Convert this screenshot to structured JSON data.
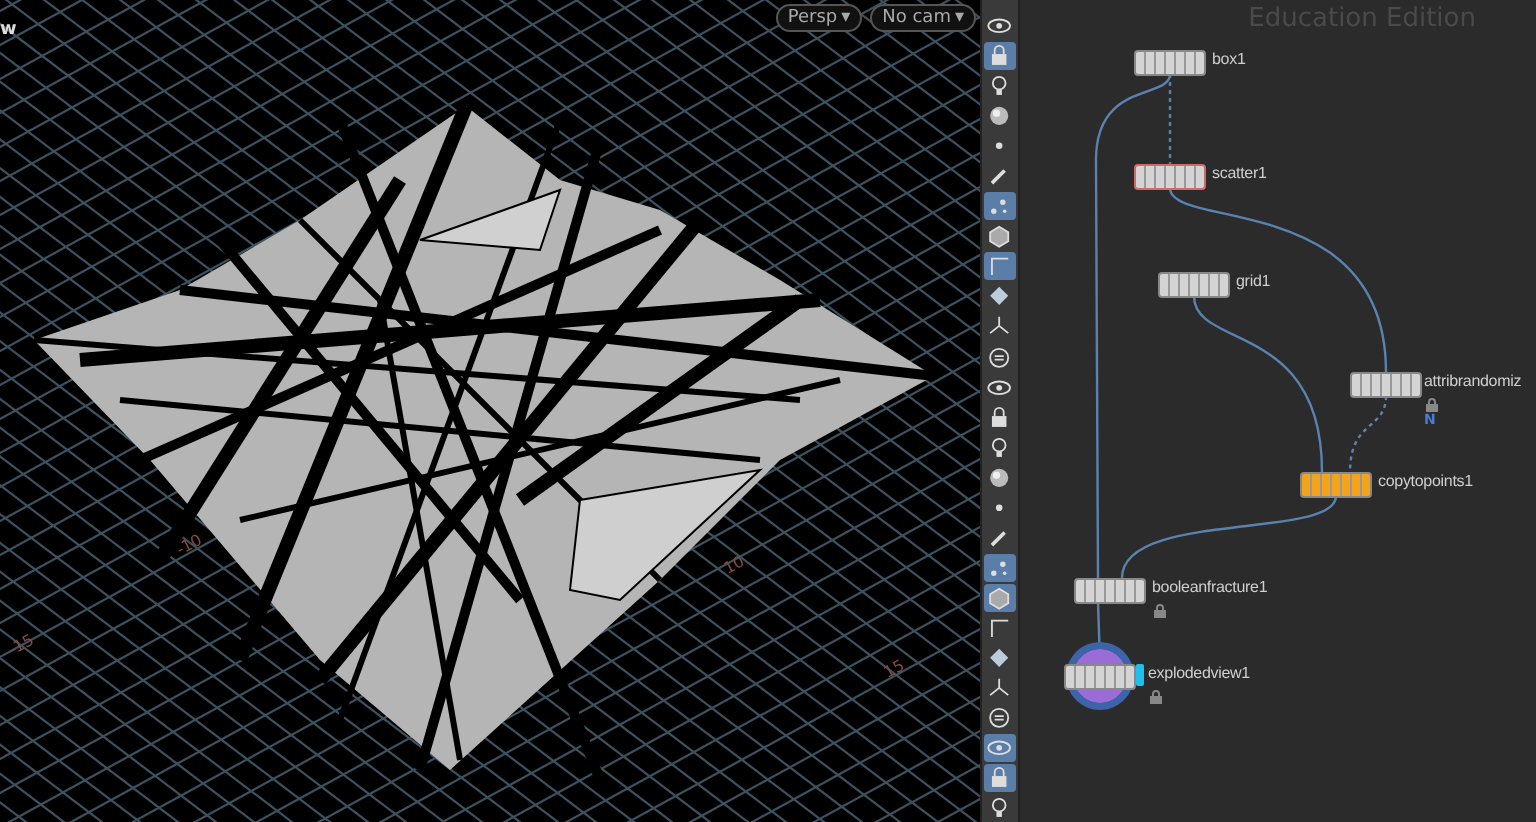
{
  "viewport": {
    "title_fragment": "w",
    "camera_buttons": [
      {
        "label": "Persp",
        "caret": "▾"
      },
      {
        "label": "No cam",
        "caret": "▾"
      }
    ],
    "grid_labels": [
      "-10",
      "-15",
      "10",
      "15"
    ]
  },
  "toolbar": [
    {
      "on": false
    },
    {
      "on": true
    },
    {
      "on": false
    },
    {
      "on": false
    },
    {
      "on": false
    },
    {
      "on": false
    },
    {
      "on": true
    },
    {
      "on": false
    },
    {
      "on": true
    },
    {
      "on": false
    },
    {
      "on": false
    },
    {
      "on": false
    },
    {
      "on": false
    },
    {
      "on": false
    },
    {
      "on": false
    },
    {
      "on": false
    },
    {
      "on": false
    },
    {
      "on": false
    },
    {
      "on": true
    },
    {
      "on": true
    },
    {
      "on": false
    },
    {
      "on": false
    },
    {
      "on": false
    },
    {
      "on": false
    },
    {
      "on": true
    },
    {
      "on": true
    },
    {
      "on": false
    }
  ],
  "network": {
    "watermark_text": "Education Edition",
    "nodes": [
      {
        "name": "box1",
        "selected": false,
        "color": "#d4d4d4",
        "display": false,
        "locked": false
      },
      {
        "name": "scatter1",
        "selected": true,
        "color": "#d4d4d4",
        "display": false,
        "locked": false
      },
      {
        "name": "grid1",
        "selected": false,
        "color": "#d4d4d4",
        "display": false,
        "locked": false
      },
      {
        "name": "attribrandomiz",
        "selected": false,
        "color": "#d4d4d4",
        "display": false,
        "locked": true,
        "badge": "N"
      },
      {
        "name": "copytopoints1",
        "selected": false,
        "color": "#f5a318",
        "display": false,
        "locked": false
      },
      {
        "name": "booleanfracture1",
        "selected": false,
        "color": "#d4d4d4",
        "display": false,
        "locked": true
      },
      {
        "name": "explodedview1",
        "selected": false,
        "color": "#d4d4d4",
        "display": true,
        "locked": true
      }
    ]
  }
}
